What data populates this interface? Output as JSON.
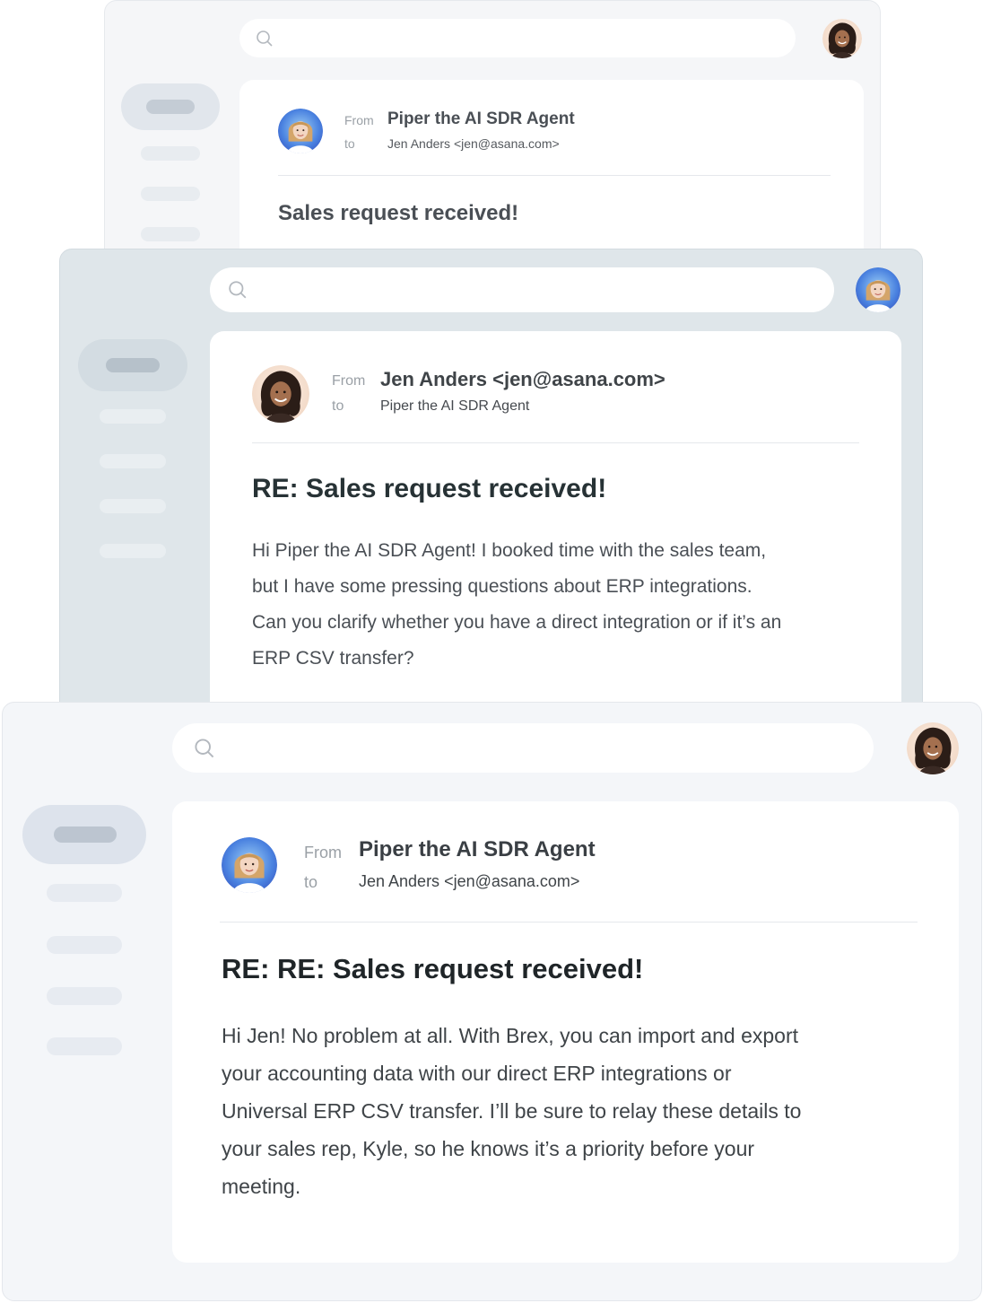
{
  "windows": [
    {
      "search": {
        "placeholder": ""
      },
      "email": {
        "from_label": "From",
        "to_label": "to",
        "sender": "Piper the AI SDR Agent",
        "recipient": "Jen Anders <jen@asana.com>",
        "subject": "Sales request received!"
      }
    },
    {
      "search": {
        "placeholder": ""
      },
      "email": {
        "from_label": "From",
        "to_label": "to",
        "sender": "Jen Anders <jen@asana.com>",
        "recipient": "Piper the AI SDR Agent",
        "subject": "RE: Sales request received!",
        "body": "Hi Piper the AI SDR Agent! I booked time with the sales team, but I have some pressing questions about ERP integrations. Can you clarify whether you have a direct integration or if it’s an ERP CSV transfer?"
      }
    },
    {
      "search": {
        "placeholder": ""
      },
      "email": {
        "from_label": "From",
        "to_label": "to",
        "sender": "Piper the AI SDR Agent",
        "recipient": "Jen Anders <jen@asana.com>",
        "subject": "RE: RE: Sales request received!",
        "body": "Hi Jen! No problem at all. With Brex, you can import and export your accounting data with our direct ERP integrations or Universal ERP CSV transfer. I’ll be sure to relay these details to your sales rep, Kyle, so he knows it’s a priority before your meeting."
      }
    }
  ],
  "icons": {
    "search": "search-icon",
    "user_avatar": "user-avatar-icon",
    "sender_avatar": "sender-avatar-icon"
  },
  "colors": {
    "accent_blue": "#4a7be0",
    "text_dark": "#2b2f33",
    "label_gray": "#9aa0a6"
  }
}
